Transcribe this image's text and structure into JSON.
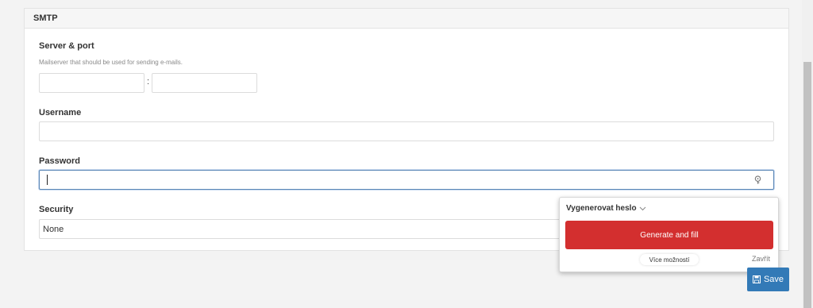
{
  "section": {
    "title": "SMTP"
  },
  "server": {
    "label": "Server & port",
    "help": "Mailserver that should be used for sending e-mails.",
    "host_value": "",
    "port_value": "",
    "separator": ":"
  },
  "username": {
    "label": "Username",
    "value": ""
  },
  "password": {
    "label": "Password",
    "value": ""
  },
  "security": {
    "label": "Security",
    "value": "None"
  },
  "password_manager": {
    "title": "Vygenerovat heslo",
    "generate_label": "Generate and fill",
    "more_options_label": "Více možností",
    "close_label": "Zavřít"
  },
  "actions": {
    "save_label": "Save"
  },
  "colors": {
    "primary": "#337ab7",
    "generate": "#d32f2f",
    "focus_border": "#5b87b6"
  },
  "icons": {
    "key": "key-icon",
    "save": "floppy-disk-icon",
    "chevron": "chevron-down-icon"
  }
}
